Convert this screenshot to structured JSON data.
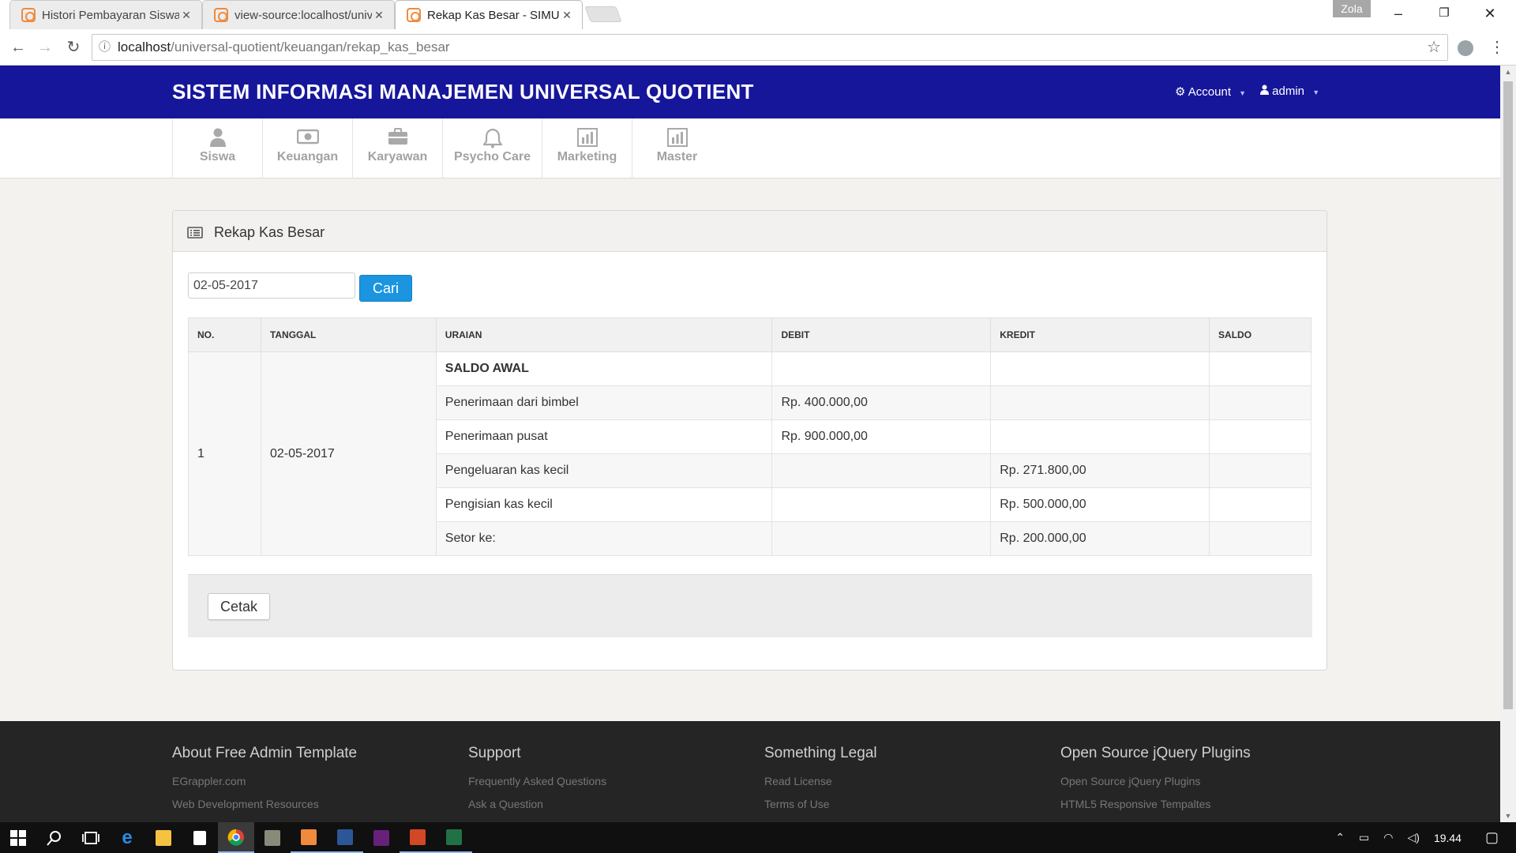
{
  "browser": {
    "tabs": [
      {
        "title": "Histori Pembayaran Siswa",
        "active": false
      },
      {
        "title": "view-source:localhost/universal-quotient",
        "active": false
      },
      {
        "title": "Rekap Kas Besar - SIMUNIQ",
        "active": true
      }
    ],
    "profile_name": "Zola",
    "url_host": "localhost",
    "url_path": "/universal-quotient/keuangan/rekap_kas_besar"
  },
  "header": {
    "brand": "SISTEM INFORMASI MANAJEMEN UNIVERSAL QUOTIENT",
    "account_label": "Account",
    "user_label": "admin"
  },
  "nav": {
    "items": [
      {
        "label": "Siswa",
        "icon": "user-icon"
      },
      {
        "label": "Keuangan",
        "icon": "money-icon"
      },
      {
        "label": "Karyawan",
        "icon": "briefcase-icon"
      },
      {
        "label": "Psycho Care",
        "icon": "bell-icon"
      },
      {
        "label": "Marketing",
        "icon": "bar-chart-icon"
      },
      {
        "label": "Master",
        "icon": "bar-chart-icon"
      }
    ]
  },
  "widget": {
    "title": "Rekap Kas Besar",
    "date_value": "02-05-2017",
    "search_label": "Cari",
    "print_label": "Cetak"
  },
  "table": {
    "headers": [
      "NO.",
      "TANGGAL",
      "URAIAN",
      "DEBIT",
      "KREDIT",
      "SALDO"
    ],
    "no": "1",
    "tanggal": "02-05-2017",
    "rows": [
      {
        "uraian": "SALDO AWAL",
        "debit": "",
        "kredit": "",
        "saldo": ""
      },
      {
        "uraian": "Penerimaan dari bimbel",
        "debit": "Rp. 400.000,00",
        "kredit": "",
        "saldo": ""
      },
      {
        "uraian": "Penerimaan pusat",
        "debit": "Rp. 900.000,00",
        "kredit": "",
        "saldo": ""
      },
      {
        "uraian": "Pengeluaran kas kecil",
        "debit": "",
        "kredit": "Rp. 271.800,00",
        "saldo": ""
      },
      {
        "uraian": "Pengisian kas kecil",
        "debit": "",
        "kredit": "Rp. 500.000,00",
        "saldo": ""
      },
      {
        "uraian": "Setor ke:",
        "debit": "",
        "kredit": "Rp. 200.000,00",
        "saldo": ""
      }
    ]
  },
  "footer": {
    "columns": [
      {
        "heading": "About Free Admin Template",
        "links": [
          "EGrappler.com",
          "Web Development Resources"
        ]
      },
      {
        "heading": "Support",
        "links": [
          "Frequently Asked Questions",
          "Ask a Question"
        ]
      },
      {
        "heading": "Something Legal",
        "links": [
          "Read License",
          "Terms of Use"
        ]
      },
      {
        "heading": "Open Source jQuery Plugins",
        "links": [
          "Open Source jQuery Plugins",
          "HTML5 Responsive Tempaltes"
        ]
      }
    ]
  },
  "taskbar": {
    "clock": "19.44"
  },
  "colors": {
    "header_bg": "#16169b",
    "primary_button": "#1b95e0",
    "footer_bg": "#252525"
  }
}
